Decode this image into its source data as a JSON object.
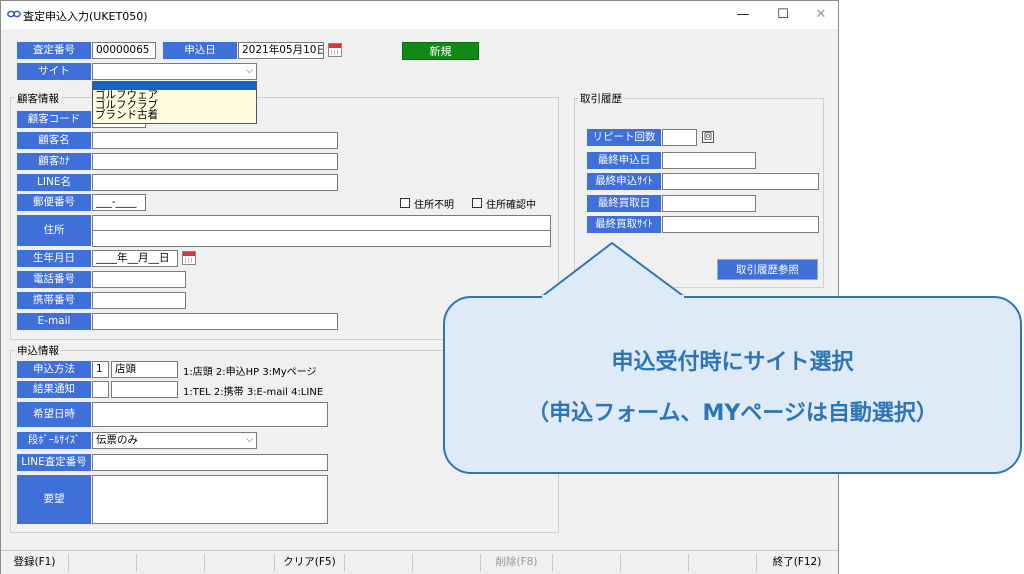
{
  "window": {
    "title": "査定申込入力(UKET050)",
    "minimize": "—",
    "maximize": "☐",
    "close": "✕"
  },
  "header": {
    "assess_no_label": "査定番号",
    "assess_no": "00000065",
    "apply_date_label": "申込日",
    "apply_date": "2021年05月10日",
    "new_badge": "新規",
    "site_label": "サイト",
    "site_value": "",
    "site_options": [
      "ゴルフウェア",
      "ゴルフクラブ",
      "ブランド古着"
    ]
  },
  "customer": {
    "group_title": "顧客情報",
    "code_label": "顧客コード",
    "name_label": "顧客名",
    "kana_label": "顧客ｶﾅ",
    "line_label": "LINE名",
    "postal_label": "郵便番号",
    "postal_value": "___-____",
    "addr_unknown": "住所不明",
    "addr_checking": "住所確認中",
    "address_label": "住所",
    "birth_label": "生年月日",
    "birth_value": "____年__月__日",
    "phone_label": "電話番号",
    "mobile_label": "携帯番号",
    "email_label": "E-mail"
  },
  "history": {
    "group_title": "取引履歴",
    "repeat_label": "リピート回数",
    "repeat_btn": "回",
    "last_apply_label": "最終申込日",
    "last_apply_site_label": "最終申込ｻｲﾄ",
    "last_buy_label": "最終買取日",
    "last_buy_site_label": "最終買取ｻｲﾄ",
    "view_btn": "取引履歴参照"
  },
  "application": {
    "group_title": "申込情報",
    "method_label": "申込方法",
    "method_code": "1",
    "method_name": "店頭",
    "method_hint": "1:店頭 2:申込HP 3:Myページ",
    "notify_label": "結果通知",
    "notify_hint": "1:TEL 2:携帯 3:E-mail 4:LINE",
    "wish_date_label": "希望日時",
    "box_size_label": "段ﾎﾞｰﾙｻｲｽﾞ",
    "box_size_value": "伝票のみ",
    "line_assess_label": "LINE査定番号",
    "request_label": "要望"
  },
  "status_bar": {
    "f1": "登録(F1)",
    "f5": "クリア(F5)",
    "f8": "削除(F8)",
    "f12": "終了(F12)"
  },
  "callout": {
    "line1": "申込受付時にサイト選択",
    "line2": "（申込フォーム、MYページは自動選択）"
  }
}
